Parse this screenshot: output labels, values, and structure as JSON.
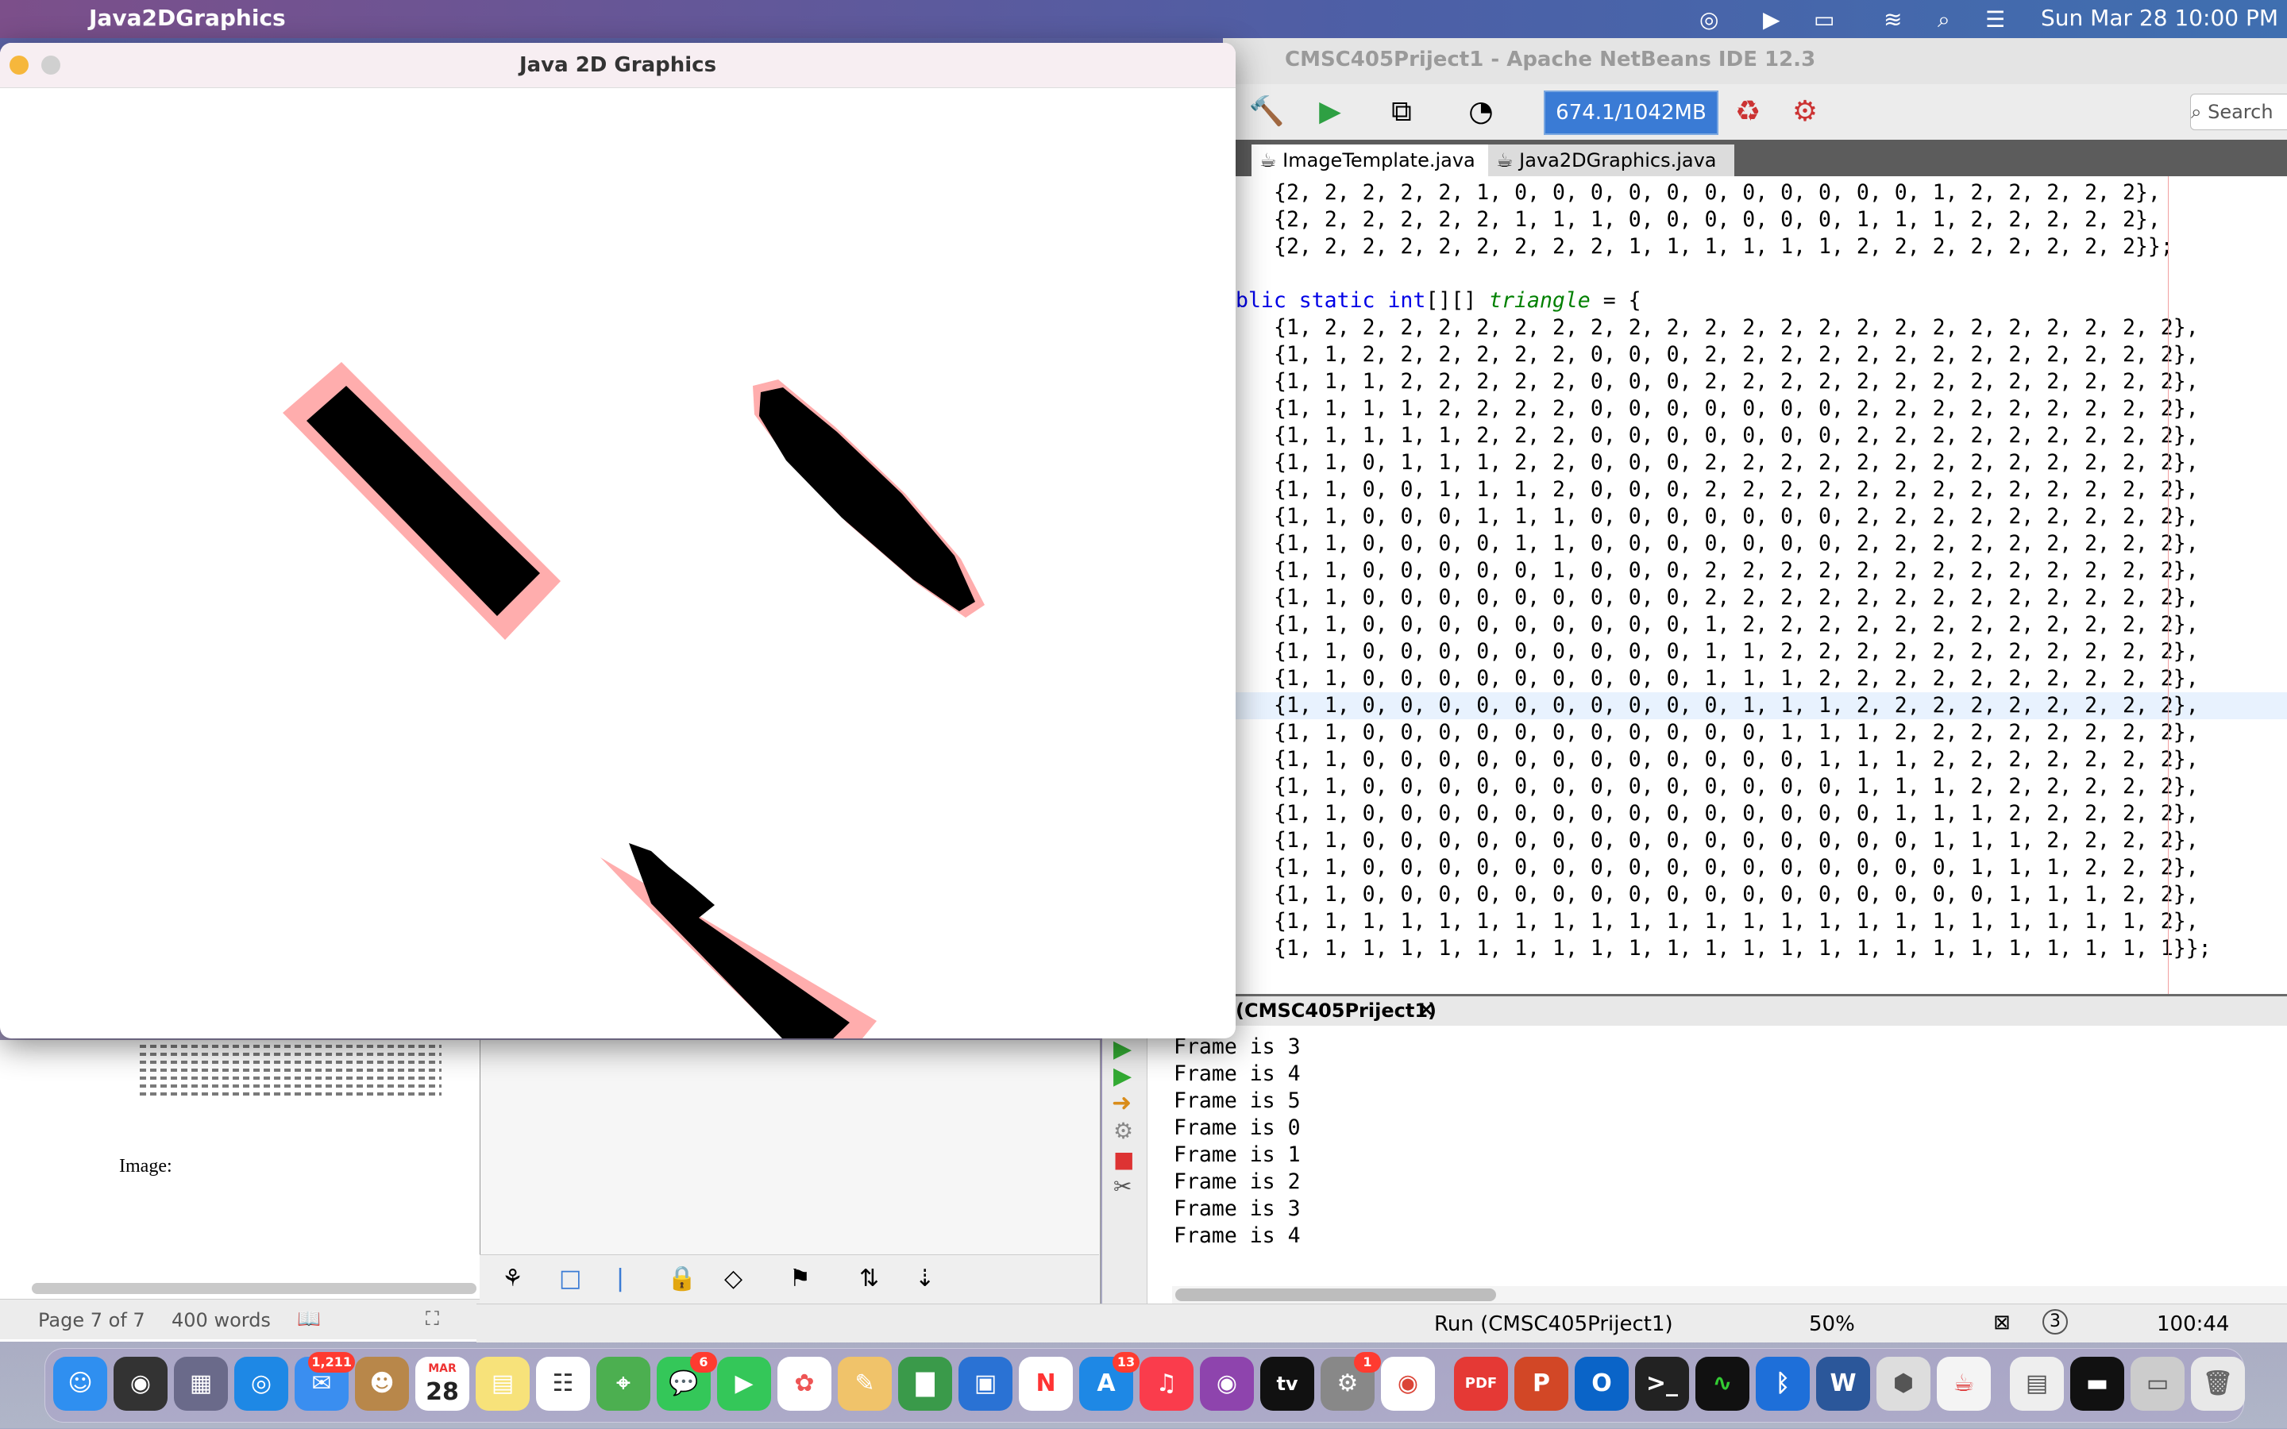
{
  "menubar": {
    "app_name": "Java2DGraphics",
    "datetime": "Sun Mar 28  10:00 PM"
  },
  "netbeans": {
    "title": "CMSC405Priject1 - Apache NetBeans IDE 12.3",
    "memory": "674.1/1042MB",
    "search_placeholder": "Search",
    "tabs": [
      "ImageTemplate.java",
      "Java2DGraphics.java"
    ],
    "code_prev_rows": [
      "{2, 2, 2, 2, 2, 1, 0, 0, 0, 0, 0, 0, 0, 0, 0, 0, 0, 1, 2, 2, 2, 2, 2},",
      "{2, 2, 2, 2, 2, 2, 1, 1, 1, 0, 0, 0, 0, 0, 0, 1, 1, 1, 2, 2, 2, 2, 2},",
      "{2, 2, 2, 2, 2, 2, 2, 2, 2, 1, 1, 1, 1, 1, 1, 2, 2, 2, 2, 2, 2, 2, 2}};"
    ],
    "decl": {
      "pre": "blic static int",
      "brackets": "[][]",
      "name": "triangle",
      "post": " = {"
    },
    "triangle_rows": [
      "{1, 2, 2, 2, 2, 2, 2, 2, 2, 2, 2, 2, 2, 2, 2, 2, 2, 2, 2, 2, 2, 2, 2, 2},",
      "{1, 1, 2, 2, 2, 2, 2, 2, 0, 0, 0, 2, 2, 2, 2, 2, 2, 2, 2, 2, 2, 2, 2, 2},",
      "{1, 1, 1, 2, 2, 2, 2, 2, 0, 0, 0, 2, 2, 2, 2, 2, 2, 2, 2, 2, 2, 2, 2, 2},",
      "{1, 1, 1, 1, 2, 2, 2, 2, 0, 0, 0, 0, 0, 0, 0, 2, 2, 2, 2, 2, 2, 2, 2, 2},",
      "{1, 1, 1, 1, 1, 2, 2, 2, 0, 0, 0, 0, 0, 0, 0, 2, 2, 2, 2, 2, 2, 2, 2, 2},",
      "{1, 1, 0, 1, 1, 1, 2, 2, 0, 0, 0, 2, 2, 2, 2, 2, 2, 2, 2, 2, 2, 2, 2, 2},",
      "{1, 1, 0, 0, 1, 1, 1, 2, 0, 0, 0, 2, 2, 2, 2, 2, 2, 2, 2, 2, 2, 2, 2, 2},",
      "{1, 1, 0, 0, 0, 1, 1, 1, 0, 0, 0, 0, 0, 0, 0, 2, 2, 2, 2, 2, 2, 2, 2, 2},",
      "{1, 1, 0, 0, 0, 0, 1, 1, 0, 0, 0, 0, 0, 0, 0, 2, 2, 2, 2, 2, 2, 2, 2, 2},",
      "{1, 1, 0, 0, 0, 0, 0, 1, 0, 0, 0, 2, 2, 2, 2, 2, 2, 2, 2, 2, 2, 2, 2, 2},",
      "{1, 1, 0, 0, 0, 0, 0, 0, 0, 0, 0, 2, 2, 2, 2, 2, 2, 2, 2, 2, 2, 2, 2, 2},",
      "{1, 1, 0, 0, 0, 0, 0, 0, 0, 0, 0, 1, 2, 2, 2, 2, 2, 2, 2, 2, 2, 2, 2, 2},",
      "{1, 1, 0, 0, 0, 0, 0, 0, 0, 0, 0, 1, 1, 2, 2, 2, 2, 2, 2, 2, 2, 2, 2, 2},",
      "{1, 1, 0, 0, 0, 0, 0, 0, 0, 0, 0, 1, 1, 1, 2, 2, 2, 2, 2, 2, 2, 2, 2, 2},",
      "{1, 1, 0, 0, 0, 0, 0, 0, 0, 0, 0, 0, 1, 1, 1, 2, 2, 2, 2, 2, 2, 2, 2, 2},",
      "{1, 1, 0, 0, 0, 0, 0, 0, 0, 0, 0, 0, 0, 1, 1, 1, 2, 2, 2, 2, 2, 2, 2, 2},",
      "{1, 1, 0, 0, 0, 0, 0, 0, 0, 0, 0, 0, 0, 0, 1, 1, 1, 2, 2, 2, 2, 2, 2, 2},",
      "{1, 1, 0, 0, 0, 0, 0, 0, 0, 0, 0, 0, 0, 0, 0, 1, 1, 1, 2, 2, 2, 2, 2, 2},",
      "{1, 1, 0, 0, 0, 0, 0, 0, 0, 0, 0, 0, 0, 0, 0, 0, 1, 1, 1, 2, 2, 2, 2, 2},",
      "{1, 1, 0, 0, 0, 0, 0, 0, 0, 0, 0, 0, 0, 0, 0, 0, 0, 1, 1, 1, 2, 2, 2, 2},",
      "{1, 1, 0, 0, 0, 0, 0, 0, 0, 0, 0, 0, 0, 0, 0, 0, 0, 0, 1, 1, 1, 2, 2, 2},",
      "{1, 1, 0, 0, 0, 0, 0, 0, 0, 0, 0, 0, 0, 0, 0, 0, 0, 0, 0, 1, 1, 1, 2, 2},",
      "{1, 1, 1, 1, 1, 1, 1, 1, 1, 1, 1, 1, 1, 1, 1, 1, 1, 1, 1, 1, 1, 1, 1, 2},",
      "{1, 1, 1, 1, 1, 1, 1, 1, 1, 1, 1, 1, 1, 1, 1, 1, 1, 1, 1, 1, 1, 1, 1, 1}};"
    ],
    "output_tab": "(CMSC405Priject1)",
    "output_lines": [
      "Frame is 3",
      "Frame is 4",
      "Frame is 5",
      "Frame is 0",
      "Frame is 1",
      "Frame is 2",
      "Frame is 3",
      "Frame is 4"
    ],
    "status": {
      "run": "Run (CMSC405Priject1)",
      "zoom": "50%",
      "badge": "3",
      "position": "100:44"
    }
  },
  "java_window": {
    "title": "Java 2D Graphics"
  },
  "word": {
    "image_label": "Image:",
    "page": "Page 7 of 7",
    "words": "400 words"
  },
  "dock": {
    "calendar_month": "MAR",
    "calendar_day": "28",
    "mail_badge": "1,211",
    "messages_badge": "6",
    "appstore_badge": "13",
    "prefs_badge": "1",
    "tv_label": "tv"
  }
}
